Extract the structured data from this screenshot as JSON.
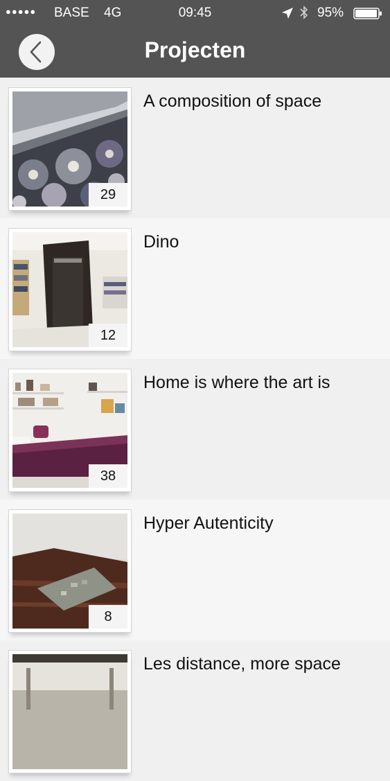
{
  "status_bar": {
    "signal": "●●●●●",
    "carrier": "BASE",
    "network": "4G",
    "time": "09:45",
    "battery": "95%"
  },
  "nav": {
    "title": "Projecten",
    "back_icon": "chevron-left-icon"
  },
  "projects": [
    {
      "title": "A composition of space",
      "count": "29"
    },
    {
      "title": "Dino",
      "count": "12"
    },
    {
      "title": "Home is where the art is",
      "count": "38"
    },
    {
      "title": "Hyper Autenticity",
      "count": "8"
    },
    {
      "title": "Les distance, more space",
      "count": ""
    }
  ],
  "colors": {
    "header_bg": "#545454",
    "row_odd": "#f0f0f1",
    "row_even": "#f6f6f7",
    "text": "#111111"
  }
}
